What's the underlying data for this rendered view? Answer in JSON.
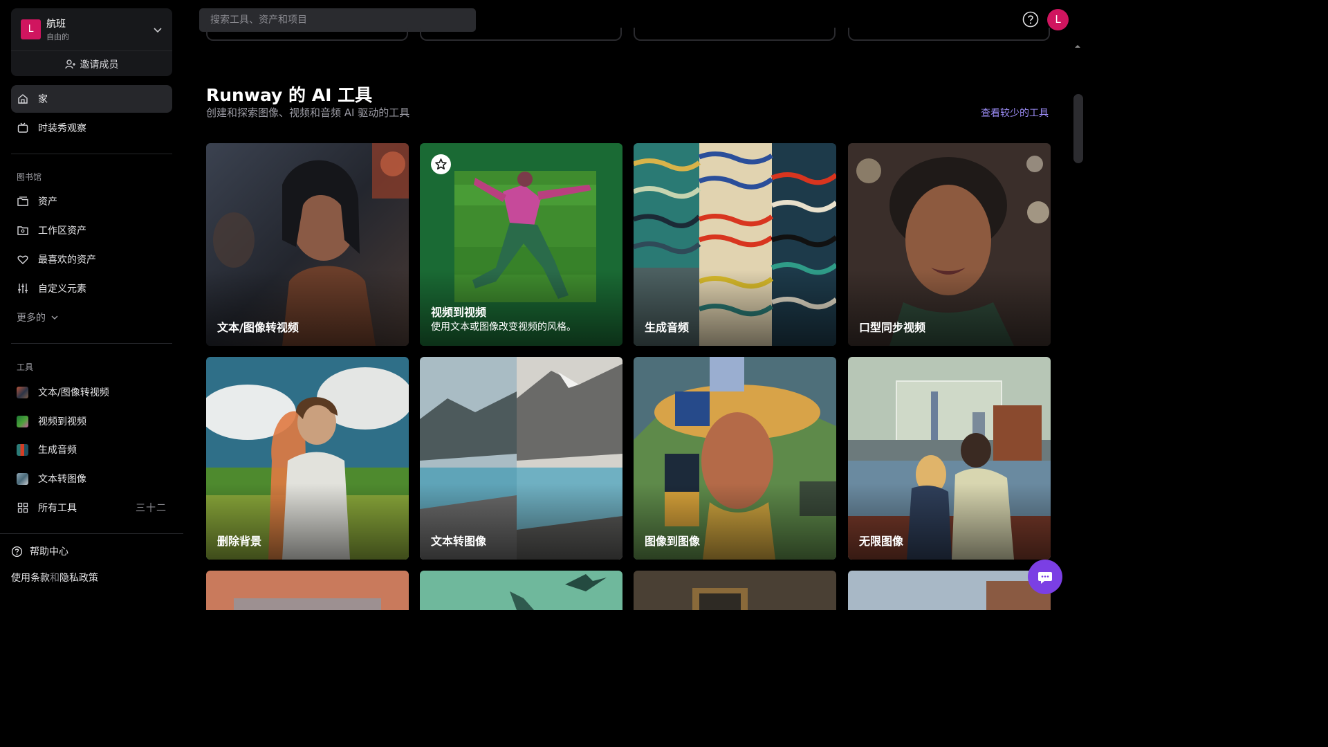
{
  "workspace": {
    "avatar_letter": "L",
    "name": "航班",
    "plan": "自由的",
    "invite_label": "邀请成员"
  },
  "nav": {
    "home": "家",
    "fashion": "时装秀观察"
  },
  "library": {
    "section": "图书馆",
    "items": [
      "资产",
      "工作区资产",
      "最喜欢的资产",
      "自定义元素"
    ],
    "more": "更多的"
  },
  "tools": {
    "section": "工具",
    "items": [
      "文本/图像转视频",
      "视频到视频",
      "生成音频",
      "文本转图像"
    ],
    "all_label": "所有工具",
    "all_count": "三十二"
  },
  "footer": {
    "help": "帮助中心",
    "terms": "使用条款",
    "and": "和",
    "privacy": "隐私政策"
  },
  "search": {
    "placeholder": "搜索工具、资产和项目"
  },
  "user": {
    "avatar_letter": "L"
  },
  "section": {
    "title": "Runway 的 AI 工具",
    "subtitle": "创建和探索图像、视频和音频 AI 驱动的工具",
    "see_less": "查看较少的工具"
  },
  "cards": [
    {
      "title": "文本/图像转视频"
    },
    {
      "title": "视频到视频",
      "desc": "使用文本或图像改变视频的风格。"
    },
    {
      "title": "生成音频"
    },
    {
      "title": "口型同步视频"
    },
    {
      "title": "删除背景"
    },
    {
      "title": "文本转图像"
    },
    {
      "title": "图像到图像"
    },
    {
      "title": "无限图像"
    }
  ],
  "colors": {
    "accent": "#d0155f",
    "link": "#9b8cf5",
    "chat": "#7b3fe4"
  }
}
